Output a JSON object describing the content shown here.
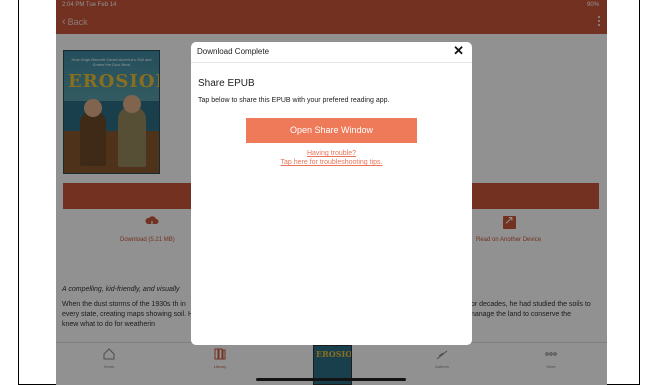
{
  "status_bar": {
    "time": "2:04 PM  Tue Feb 14",
    "right": "90%"
  },
  "nav": {
    "back_label": "Back"
  },
  "book": {
    "cover_title": "EROSION",
    "cover_subtitle": "How Hugh Bennett Saved America's Soil and Ended the Dust Bowl"
  },
  "actions": {
    "download_label": "Download (5.21 MB)",
    "read_label": "Read on Another Device"
  },
  "description": {
    "tagline": "A compelling, kid-friendly, and visually",
    "left_text": "When the dust storms of the 1930s th in every state, creating maps showing soil. He knew what to do for weatherin",
    "right_text": "for decades, he had studied the soils to manage the land to conserve the"
  },
  "tabbar": {
    "home": "Home",
    "library": "Library",
    "cover": "EROSION",
    "authors": "Authors",
    "more": "More"
  },
  "modal": {
    "title": "Download Complete",
    "close": "✕",
    "share_title": "Share EPUB",
    "share_text": "Tap below to share this EPUB with your prefered reading app.",
    "button_label": "Open Share Window",
    "trouble_line1": "Having trouble?",
    "trouble_line2": "Tap here for troubleshooting tips."
  },
  "colors": {
    "accent": "#c8573a",
    "button": "#ef7a5a",
    "link": "#e8745a"
  }
}
